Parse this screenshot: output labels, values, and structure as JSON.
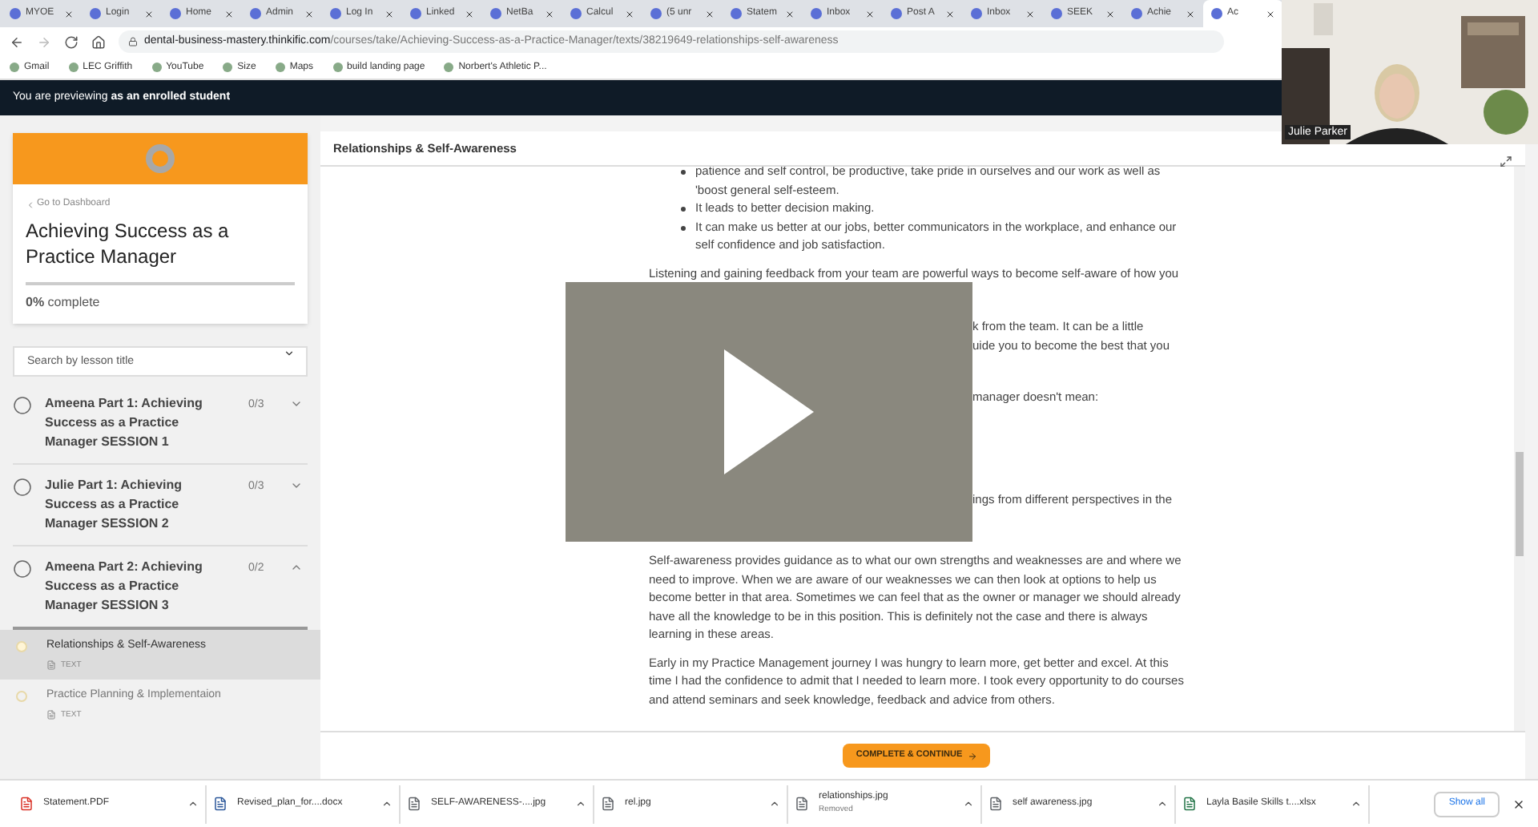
{
  "browser": {
    "tabs": [
      {
        "title": "MYOE",
        "selected": false
      },
      {
        "title": "Login",
        "selected": false
      },
      {
        "title": "Home",
        "selected": false
      },
      {
        "title": "Admin",
        "selected": false
      },
      {
        "title": "Log In",
        "selected": false
      },
      {
        "title": "Linked",
        "selected": false
      },
      {
        "title": "NetBa",
        "selected": false
      },
      {
        "title": "Calcul",
        "selected": false
      },
      {
        "title": "(5 unr",
        "selected": false
      },
      {
        "title": "Statem",
        "selected": false
      },
      {
        "title": "Inbox",
        "selected": false
      },
      {
        "title": "Post A",
        "selected": false
      },
      {
        "title": "Inbox",
        "selected": false
      },
      {
        "title": "SEEK",
        "selected": false
      },
      {
        "title": "Achie",
        "selected": false
      },
      {
        "title": "Ac",
        "selected": true
      }
    ],
    "address": {
      "host": "dental-business-mastery.thinkific.com",
      "path": "/courses/take/Achieving-Success-as-a-Practice-Manager/texts/38219649-relationships-self-awareness"
    },
    "bookmarks": [
      "Gmail",
      "LEC Griffith",
      "YouTube",
      "Size",
      "Maps",
      "build landing page",
      "Norbert's Athletic P..."
    ]
  },
  "preview_banner": "You are previewing **as an enrolled student**",
  "sidebar": {
    "back_link": "Go to Dashboard",
    "course_title": "Achieving Success as a Practice Manager",
    "progress": {
      "level": 0,
      "label": "**0%** complete"
    },
    "search": {
      "placeholder": "Search by lesson title"
    },
    "chapters": [
      {
        "title": "Ameena Part 1: Achieving Success as a Practice Manager SESSION 1",
        "count": "0/3",
        "expanded": false
      },
      {
        "title": "Julie Part 1: Achieving Success as a Practice Manager SESSION 2",
        "count": "0/3",
        "expanded": false
      },
      {
        "title": "Ameena Part 2: Achieving Success as a Practice Manager SESSION 3",
        "count": "0/2",
        "expanded": true,
        "lessons": [
          {
            "title": "Relationships & Self-Awareness",
            "type": "TEXT",
            "selected": true
          },
          {
            "title": "Practice Planning & Implementaion",
            "type": "TEXT",
            "selected": false
          }
        ]
      }
    ]
  },
  "content": {
    "title": "Relationships & Self-Awareness",
    "blocks": [
      {
        "kind": "bullets",
        "items": [
          "patience and self control, be productive, take pride in ourselves and our work as well as 'boost general self-esteem.",
          "It leads to better decision making.",
          "It can make us better at our jobs, better communicators in the workplace, and enhance our self confidence and job satisfaction."
        ]
      },
      {
        "kind": "paragraph",
        "text": "Listening and gaining feedback from your team are powerful ways to become self-aware of how you"
      },
      {
        "kind": "player",
        "fragments": [
          "k from the team. It can be a little",
          "uide you to become the best that you",
          "manager doesn't mean:",
          "ings from different perspectives in the"
        ]
      },
      {
        "kind": "paragraph",
        "text": "Self-awareness provides guidance as to what our own strengths and weaknesses are and where we need to improve. When we are aware of our weaknesses we can then look at options to help us become better in that area. Sometimes we can feel that as the owner or manager we should already have all the knowledge to be in this position. This is definitely not the case and there is always learning  in these areas."
      },
      {
        "kind": "paragraph",
        "text": "Early in my Practice Management journey I was hungry to learn more, get better and excel. At this time I had the confidence to admit that I needed to learn more. I took every opportunity to do courses and attend seminars and seek knowledge, feedback and advice from others."
      }
    ],
    "button": "COMPLETE & CONTINUE"
  },
  "downloads": {
    "items": [
      {
        "name": "Statement.PDF",
        "kind": "pdf"
      },
      {
        "name": "Revised_plan_for....docx",
        "kind": "doc"
      },
      {
        "name": "SELF-AWARENESS-....jpg"
      },
      {
        "name": "rel.jpg"
      },
      {
        "name": "relationships.jpg",
        "status": "Removed"
      },
      {
        "name": "self awareness.jpg"
      },
      {
        "name": "Layla Basile Skills t....xlsx",
        "kind": "sheet"
      }
    ],
    "show_all": "Show all"
  },
  "webcam": {
    "name": "Julie Parker"
  }
}
